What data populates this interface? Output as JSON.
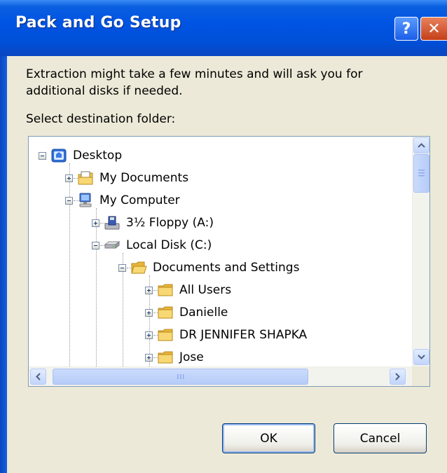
{
  "dialog": {
    "title": "Pack and Go Setup",
    "help_label": "?",
    "close_label": "✕",
    "message": "Extraction might take a few minutes and will ask you for additional disks if needed.",
    "select_label": "Select destination folder:",
    "ok_label": "OK",
    "cancel_label": "Cancel"
  },
  "tree": {
    "nodes": [
      {
        "label": "Desktop",
        "icon": "desktop-icon",
        "expanded": true
      },
      {
        "label": "My Documents",
        "icon": "my-documents-icon",
        "expanded": false
      },
      {
        "label": "My Computer",
        "icon": "my-computer-icon",
        "expanded": true
      },
      {
        "label": "3½ Floppy (A:)",
        "icon": "floppy-drive-icon",
        "expanded": false
      },
      {
        "label": "Local Disk (C:)",
        "icon": "hard-disk-icon",
        "expanded": true
      },
      {
        "label": "Documents and Settings",
        "icon": "folder-open-icon",
        "expanded": true
      },
      {
        "label": "All Users",
        "icon": "folder-icon",
        "expanded": false
      },
      {
        "label": "Danielle",
        "icon": "folder-icon",
        "expanded": false
      },
      {
        "label": "DR JENNIFER SHAPKA",
        "icon": "folder-icon",
        "expanded": false
      },
      {
        "label": "Jose",
        "icon": "folder-icon",
        "expanded": false
      }
    ]
  },
  "colors": {
    "titlebar": "#0054e3",
    "dialog_bg": "#ece9d8",
    "scrollbar": "#c2d5fb",
    "folder": "#f5c84a"
  }
}
